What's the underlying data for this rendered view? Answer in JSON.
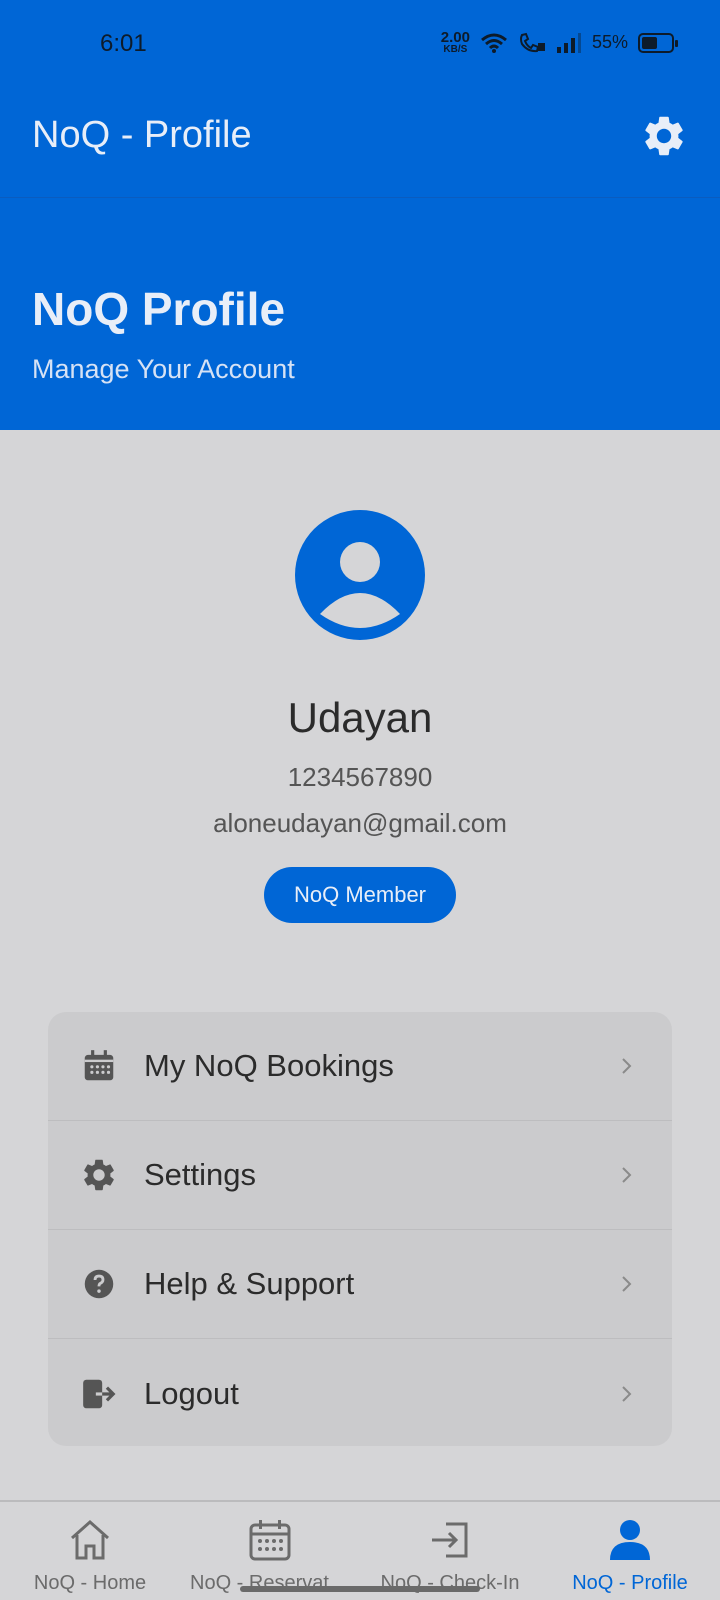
{
  "status_bar": {
    "time": "6:01",
    "net_speed_value": "2.00",
    "net_speed_unit": "KB/S",
    "battery_percent": "55%",
    "battery_level": 0.55,
    "icons": [
      "wifi-icon",
      "call-icon",
      "signal-icon",
      "battery-icon"
    ]
  },
  "app_bar": {
    "title": "NoQ - Profile",
    "action_icon": "gear-icon"
  },
  "header": {
    "title": "NoQ Profile",
    "subtitle": "Manage Your Account"
  },
  "profile": {
    "avatar_icon": "person-icon",
    "name": "Udayan",
    "phone": "1234567890",
    "email": "aloneudayan@gmail.com",
    "badge": "NoQ Member"
  },
  "menu": {
    "items": [
      {
        "label": "My NoQ Bookings",
        "icon": "calendar-icon"
      },
      {
        "label": "Settings",
        "icon": "gear-icon"
      },
      {
        "label": "Help & Support",
        "icon": "help-icon"
      },
      {
        "label": "Logout",
        "icon": "logout-icon"
      }
    ]
  },
  "bottom_nav": {
    "items": [
      {
        "label": "NoQ - Home",
        "icon": "home-icon",
        "active": false
      },
      {
        "label": "NoQ - Reservations",
        "icon": "calendar-icon",
        "active": false
      },
      {
        "label": "NoQ - Check-In",
        "icon": "check-in-icon",
        "active": false
      },
      {
        "label": "NoQ - Profile",
        "icon": "person-icon",
        "active": true
      }
    ]
  },
  "colors": {
    "primary": "#0066d6",
    "background": "#d5d5d7",
    "card": "#cbcbcd",
    "text_dark": "#2b2b2b",
    "text_muted": "#555555"
  }
}
